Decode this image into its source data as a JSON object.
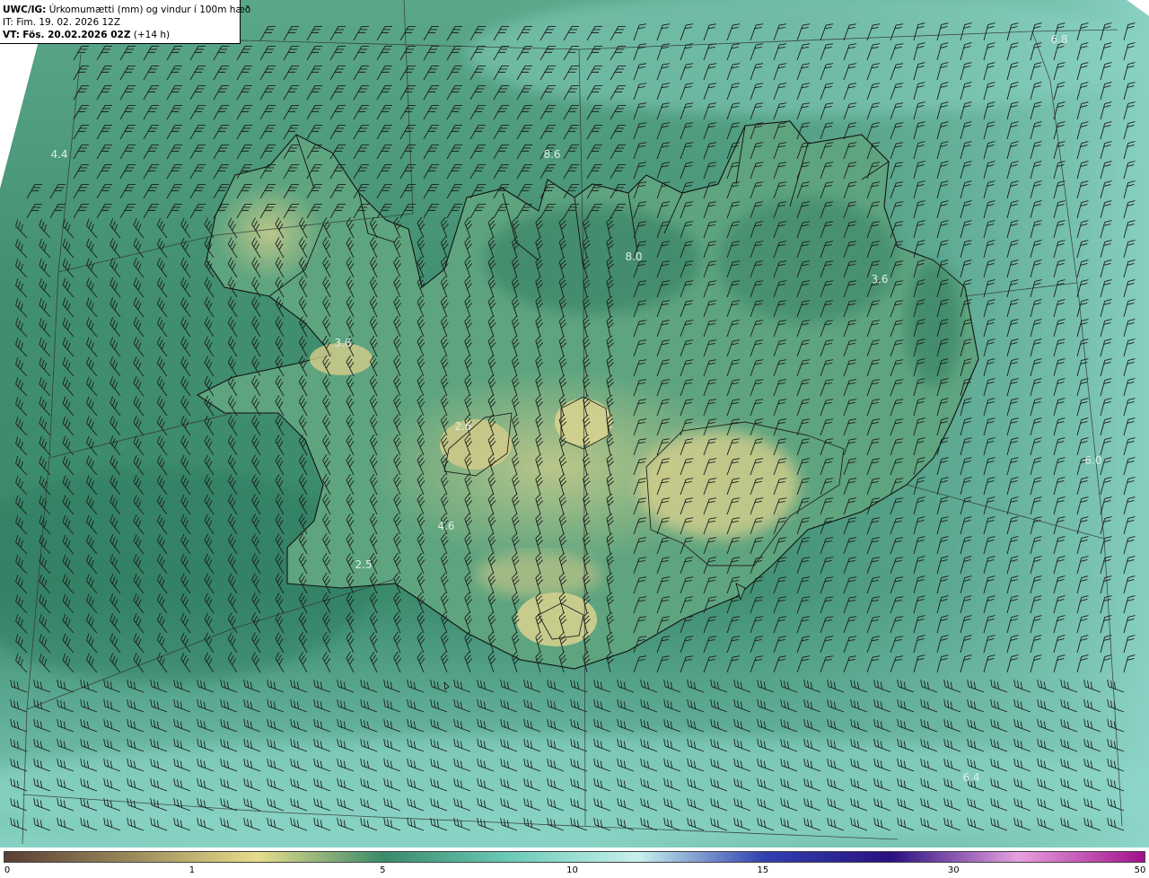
{
  "header": {
    "product": "UWC/IG:",
    "description": "Úrkomumætti (mm) og vindur í 100m hæð",
    "initial_time": "IT: Fim. 19. 02. 2026 12Z",
    "valid_prefix": "VT:",
    "valid_time": "Fös. 20.02.2026 02Z",
    "lead": "(+14 h)"
  },
  "colorbar": {
    "ticks": [
      "0",
      "1",
      "5",
      "10",
      "15",
      "30",
      "50"
    ],
    "stops": [
      "#5a3e34",
      "#9a8a5a",
      "#e6dd8a",
      "#3a8a6a",
      "#6ccab8",
      "#c8f0ee",
      "#3040b0",
      "#2a1080",
      "#e8a0e0",
      "#a0108a"
    ]
  },
  "map_values": [
    "6.8",
    "4.4",
    "8.6",
    "8.0",
    "3.6",
    "3.6",
    "6.0",
    "2.6",
    "4.6",
    "2.5",
    "6.4"
  ],
  "colors": {
    "sea_dark": "#2f7c61",
    "sea_mid": "#4e9c80",
    "sea_light": "#7fcbbd",
    "land_yellow": "#cfc988",
    "land_green": "#5c9f7c",
    "coast": "#111111"
  }
}
